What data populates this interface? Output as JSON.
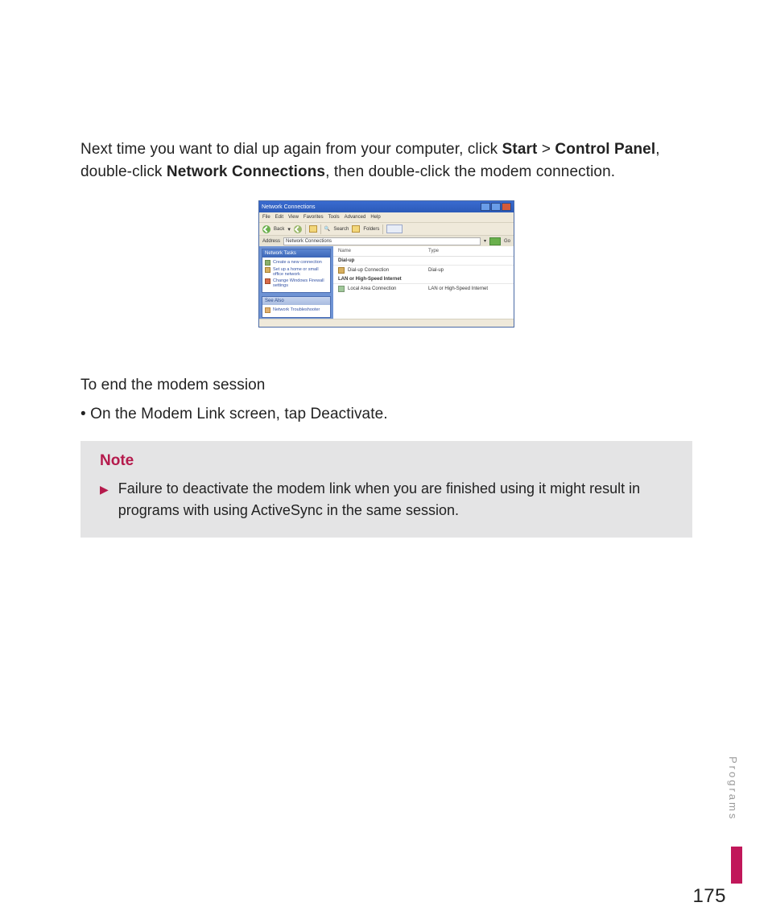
{
  "intro": {
    "pre": "Next time you want to dial up again from your computer, click ",
    "b1": "Start",
    "gt": " > ",
    "b2": "Control Panel",
    "mid": ", double-click ",
    "b3": "Network Connections",
    "post": ", then double-click the modem connection."
  },
  "screenshot": {
    "title": "Network Connections",
    "menu": [
      "File",
      "Edit",
      "View",
      "Favorites",
      "Tools",
      "Advanced",
      "Help"
    ],
    "toolbar": {
      "back": "Back",
      "search": "Search",
      "folders": "Folders"
    },
    "address": {
      "label": "Address",
      "value": "Network Connections",
      "go": "Go"
    },
    "sidebar": {
      "panel1": {
        "title": "Network Tasks",
        "items": [
          "Create a new connection",
          "Set up a home or small office network",
          "Change Windows Firewall settings"
        ]
      },
      "panel2": {
        "title": "See Also",
        "items": [
          "Network Troubleshooter"
        ]
      }
    },
    "columns": {
      "name": "Name",
      "type": "Type"
    },
    "groups": [
      {
        "label": "Dial-up",
        "rows": [
          {
            "name": "Dial-up Connection",
            "type": "Dial-up"
          }
        ]
      },
      {
        "label": "LAN or High-Speed Internet",
        "rows": [
          {
            "name": "Local Area Connection",
            "type": "LAN or High-Speed Internet"
          }
        ]
      }
    ]
  },
  "end_heading": "To end the modem session",
  "end_bullet": "• On the Modem Link screen, tap Deactivate.",
  "note": {
    "title": "Note",
    "text": "Failure to deactivate the modem link when you are finished using it might result in programs with using ActiveSync in the same session."
  },
  "side_label": "Programs",
  "page_number": "175"
}
